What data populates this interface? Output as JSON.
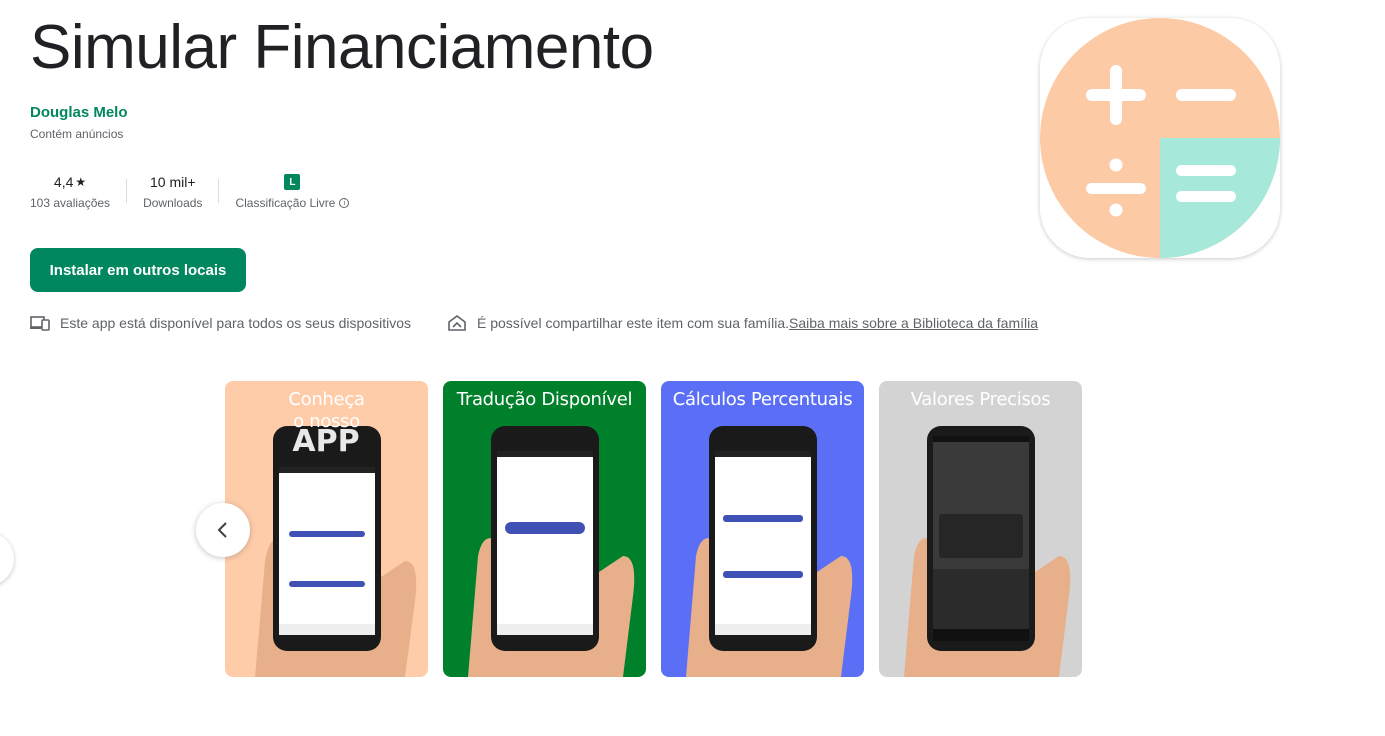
{
  "app": {
    "title": "Simular Financiamento",
    "developer": "Douglas Melo",
    "ads_notice": "Contém anúncios"
  },
  "stats": {
    "rating_value": "4,4",
    "rating_star": "★",
    "reviews": "103 avaliações",
    "downloads_value": "10 mil+",
    "downloads_label": "Downloads",
    "content_badge": "L",
    "content_label": "Classificação Livre",
    "info_glyph": "i"
  },
  "install_button": "Instalar em outros locais",
  "availability": {
    "devices_text": "Este app está disponível para todos os seus dispositivos",
    "family_text": "É possível compartilhar este item com sua família.",
    "family_link": "Saiba mais sobre a Biblioteca da família"
  },
  "screenshots": [
    {
      "caption_line1": "Conheça",
      "caption_line2": "o nosso",
      "caption_line3": "APP",
      "bg": "#ffccaa"
    },
    {
      "caption_line1": "Tradução Disponível",
      "bg": "#00802b"
    },
    {
      "caption_line1": "Cálculos Percentuais",
      "bg": "#5a6ff5"
    },
    {
      "caption_line1": "Valores Precisos",
      "bg": "#d3d3d3"
    }
  ],
  "colors": {
    "brand_green": "#01875f",
    "icon_peach": "#fdcaa6",
    "icon_mint": "#a6e8da"
  },
  "icons": {
    "nav_prev": "chevron-left-icon",
    "devices": "devices-icon",
    "family": "family-home-icon"
  }
}
